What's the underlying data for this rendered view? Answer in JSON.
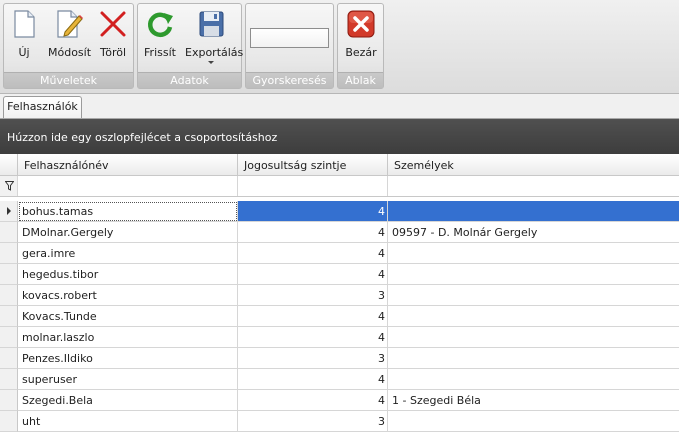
{
  "ribbon": {
    "groups": [
      {
        "caption": "Műveletek",
        "buttons": [
          {
            "label": "Új",
            "icon": "new-document-icon"
          },
          {
            "label": "Módosít",
            "icon": "edit-document-icon"
          },
          {
            "label": "Töröl",
            "icon": "delete-x-icon"
          }
        ]
      },
      {
        "caption": "Adatok",
        "buttons": [
          {
            "label": "Frissít",
            "icon": "refresh-icon"
          },
          {
            "label": "Exportálás",
            "icon": "save-disk-icon"
          }
        ]
      },
      {
        "caption": "Gyorskeresés",
        "search_value": ""
      },
      {
        "caption": "Ablak",
        "buttons": [
          {
            "label": "Bezár",
            "icon": "close-window-icon"
          }
        ]
      }
    ]
  },
  "tabs": [
    {
      "label": "Felhasználók",
      "active": true
    }
  ],
  "group_panel": {
    "text": "Húzzon ide egy oszlopfejlécet a csoportosításhoz"
  },
  "grid": {
    "columns": [
      "Felhasználónév",
      "Jogosultság szintje",
      "Személyek"
    ],
    "filter_values": [
      "",
      "",
      ""
    ],
    "rows": [
      {
        "user": "bohus.tamas",
        "level": "4",
        "person": "",
        "selected": true
      },
      {
        "user": "DMolnar.Gergely",
        "level": "4",
        "person": "09597 - D. Molnár Gergely"
      },
      {
        "user": "gera.imre",
        "level": "4",
        "person": ""
      },
      {
        "user": "hegedus.tibor",
        "level": "4",
        "person": ""
      },
      {
        "user": "kovacs.robert",
        "level": "3",
        "person": ""
      },
      {
        "user": "Kovacs.Tunde",
        "level": "4",
        "person": ""
      },
      {
        "user": "molnar.laszlo",
        "level": "4",
        "person": ""
      },
      {
        "user": "Penzes.Ildiko",
        "level": "3",
        "person": ""
      },
      {
        "user": "superuser",
        "level": "4",
        "person": ""
      },
      {
        "user": "Szegedi.Bela",
        "level": "4",
        "person": "1 - Szegedi Béla"
      },
      {
        "user": "uht",
        "level": "3",
        "person": ""
      }
    ]
  },
  "colors": {
    "selection": "#3470d0",
    "group_panel": "#474747",
    "delete_red": "#d22020",
    "refresh_green": "#2e9a2e"
  }
}
